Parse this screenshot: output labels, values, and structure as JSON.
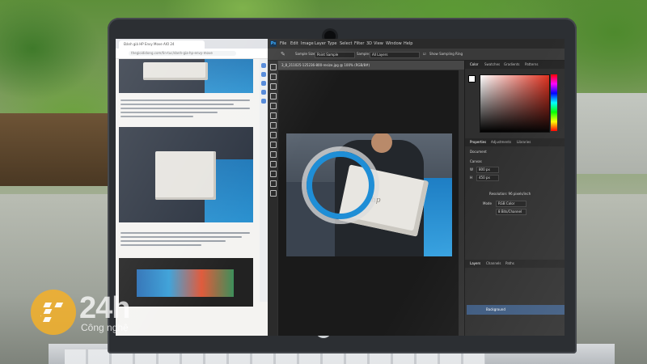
{
  "browser": {
    "tab_title": "Đánh giá HP Envy Move AIO 24",
    "url": "thegioididong.com/tin-tuc/danh-gia-hp-envy-move"
  },
  "photoshop": {
    "menu": [
      "File",
      "Edit",
      "Image",
      "Layer",
      "Type",
      "Select",
      "Filter",
      "3D",
      "View",
      "Window",
      "Help"
    ],
    "options": {
      "sample_size_label": "Sample Size:",
      "sample_size_value": "Point Sample",
      "sample_label": "Sample:",
      "sample_value": "All Layers",
      "ring_label": "Show Sampling Ring"
    },
    "document_tab": "3_8_211025-125236-800-resize.jpg @ 100% (RGB/8#)",
    "panel_tabs_top": [
      "Color",
      "Swatches",
      "Gradients",
      "Patterns"
    ],
    "panel_tabs_props": [
      "Properties",
      "Adjustments",
      "Libraries"
    ],
    "props": {
      "section": "Document",
      "canvas_label": "Canvas",
      "w_value": "800 px",
      "h_value": "450 px",
      "resolution": "Resolution: 96 pixels/inch",
      "mode_label": "Mode",
      "mode_value": "RGB Color",
      "depth_value": "8 Bits/Channel"
    },
    "panel_tabs_layers": [
      "Layers",
      "Channels",
      "Paths"
    ],
    "layer_name": "Background"
  },
  "watermark": {
    "brand": "24h",
    "tagline": "Công nghệ"
  },
  "colors": {
    "ps_accent": "#31a8ff",
    "watermark_orange": "#f5b028"
  }
}
